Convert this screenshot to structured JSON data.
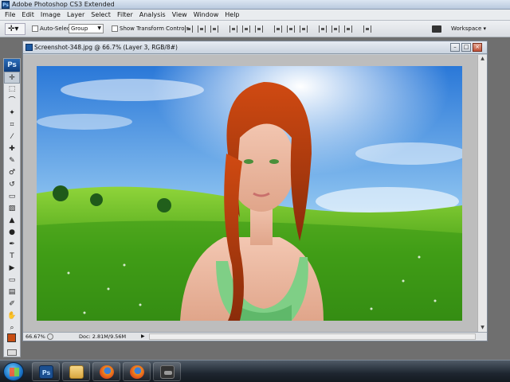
{
  "app": {
    "title": "Adobe Photoshop CS3 Extended",
    "logo": "Ps"
  },
  "menubar": {
    "items": [
      "File",
      "Edit",
      "Image",
      "Layer",
      "Select",
      "Filter",
      "Analysis",
      "View",
      "Window",
      "Help"
    ]
  },
  "options": {
    "tool_preset_icon": "move-tool-icon",
    "auto_select_label": "Auto-Select:",
    "auto_select_checked": false,
    "auto_select_value": "Group",
    "show_transform_label": "Show Transform Controls",
    "show_transform_checked": false,
    "workspace_label": "Workspace ▾"
  },
  "toolbox": {
    "logo": "Ps",
    "tools": [
      {
        "name": "move-tool",
        "glyph": "✛",
        "active": true
      },
      {
        "name": "marquee-tool",
        "glyph": "⬚"
      },
      {
        "name": "lasso-tool",
        "glyph": "⌒"
      },
      {
        "name": "magic-wand-tool",
        "glyph": "✦"
      },
      {
        "name": "crop-tool",
        "glyph": "⌗"
      },
      {
        "name": "slice-tool",
        "glyph": "⁄"
      },
      {
        "name": "healing-brush-tool",
        "glyph": "✚"
      },
      {
        "name": "brush-tool",
        "glyph": "✎"
      },
      {
        "name": "clone-stamp-tool",
        "glyph": "♂"
      },
      {
        "name": "history-brush-tool",
        "glyph": "↺"
      },
      {
        "name": "eraser-tool",
        "glyph": "▭"
      },
      {
        "name": "gradient-tool",
        "glyph": "▨"
      },
      {
        "name": "blur-tool",
        "glyph": "▲"
      },
      {
        "name": "dodge-tool",
        "glyph": "●"
      },
      {
        "name": "pen-tool",
        "glyph": "✒"
      },
      {
        "name": "type-tool",
        "glyph": "T"
      },
      {
        "name": "path-selection-tool",
        "glyph": "▶"
      },
      {
        "name": "shape-tool",
        "glyph": "▭"
      },
      {
        "name": "notes-tool",
        "glyph": "▤"
      },
      {
        "name": "eyedropper-tool",
        "glyph": "✐"
      },
      {
        "name": "hand-tool",
        "glyph": "✋"
      },
      {
        "name": "zoom-tool",
        "glyph": "⌕"
      }
    ],
    "foreground_color": "#c84e14",
    "background_color": "#ffffff"
  },
  "document": {
    "title": "Screenshot-348.jpg @ 66.7% (Layer 3, RGB/8#)",
    "zoom": "66.67%",
    "doc_size": "Doc: 2.81M/9.56M"
  },
  "taskbar": {
    "items": [
      {
        "name": "photoshop",
        "label": "Ps"
      },
      {
        "name": "windows-explorer"
      },
      {
        "name": "firefox-1"
      },
      {
        "name": "firefox-2"
      },
      {
        "name": "game"
      }
    ]
  }
}
